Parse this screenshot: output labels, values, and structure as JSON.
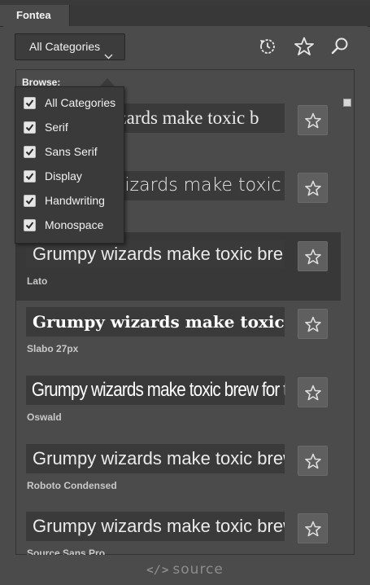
{
  "tab": {
    "label": "Fontea"
  },
  "category_button": {
    "label": "All Categories"
  },
  "browse": {
    "label": "Browse:"
  },
  "dropdown": {
    "items": [
      {
        "label": "All Categories",
        "checked": true
      },
      {
        "label": "Serif",
        "checked": true
      },
      {
        "label": "Sans Serif",
        "checked": true
      },
      {
        "label": "Display",
        "checked": true
      },
      {
        "label": "Handwriting",
        "checked": true
      },
      {
        "label": "Monospace",
        "checked": true
      }
    ]
  },
  "fonts": [
    {
      "preview": "Grumpy wizards make toxic b",
      "name": ""
    },
    {
      "preview": "Grumpy wizards make toxic br",
      "name": ""
    },
    {
      "preview": "Grumpy wizards make toxic bre",
      "name": "Lato"
    },
    {
      "preview": "Grumpy wizards make toxic brev",
      "name": "Slabo 27px"
    },
    {
      "preview": "Grumpy wizards make toxic brew for th",
      "name": "Oswald"
    },
    {
      "preview": "Grumpy wizards make toxic brew",
      "name": "Roboto Condensed"
    },
    {
      "preview": "Grumpy wizards make toxic brew",
      "name": "Source Sans Pro"
    }
  ],
  "footer": {
    "code": "</>",
    "label": "source"
  },
  "icons": {
    "history": "history-icon",
    "favorites": "star-icon",
    "search": "search-icon"
  }
}
